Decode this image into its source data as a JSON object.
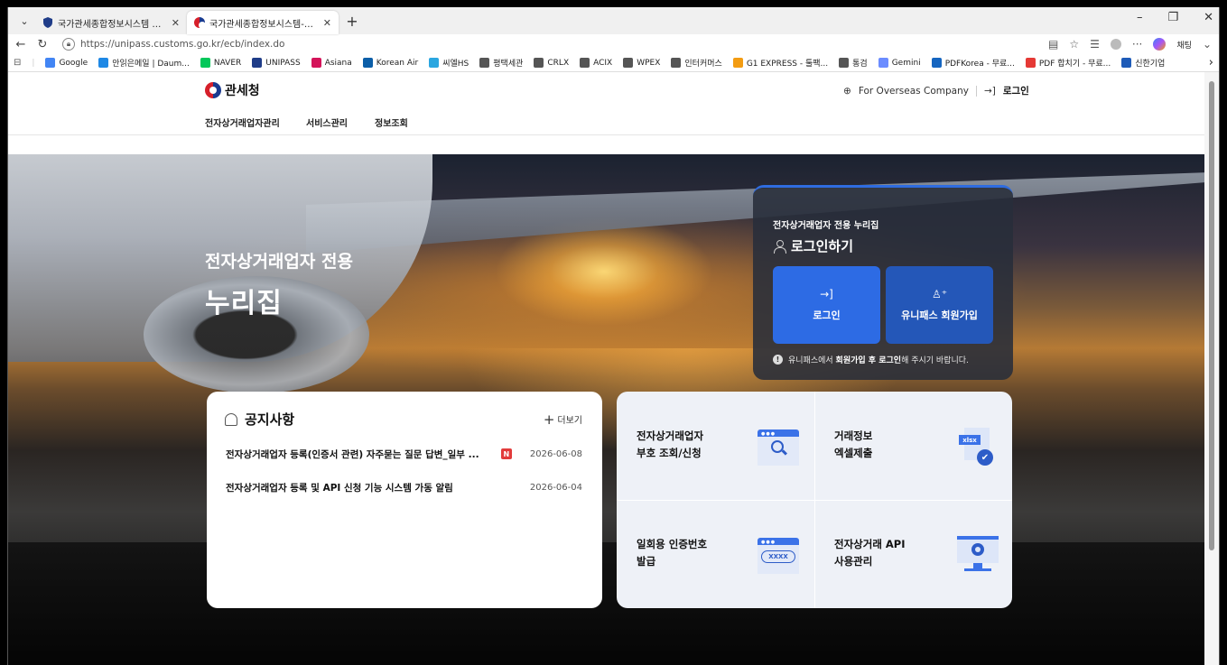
{
  "browser": {
    "tabs": [
      {
        "title": "국가관세종합정보시스템 서비스",
        "active": false
      },
      {
        "title": "국가관세종합정보시스템-전자상거래",
        "active": true
      }
    ],
    "url": "https://unipass.customs.go.kr/ecb/index.do",
    "profile_label": "채팅",
    "bookmarks": [
      "Google",
      "안읽은메일 | Daum...",
      "NAVER",
      "UNIPASS",
      "Asiana",
      "Korean Air",
      "씨엘HS",
      "평택세관",
      "CRLX",
      "ACIX",
      "WPEX",
      "인터커머스",
      "G1 EXPRESS - 툴팩...",
      "통검",
      "Gemini",
      "PDFKorea - 무료...",
      "PDF 합치기 - 무료...",
      "신한기업"
    ],
    "bookmark_colors": [
      "#4285f4",
      "#1e88e5",
      "#03c75a",
      "#1f3c88",
      "#d4145a",
      "#0b5ea8",
      "#2aa6e0",
      "#555",
      "#555",
      "#555",
      "#555",
      "#555",
      "#f39c12",
      "#555",
      "#6b8cff",
      "#1565c0",
      "#e53935",
      "#1e5bb8"
    ]
  },
  "header": {
    "logo_text": "관세청",
    "overseas_label": "For Overseas Company",
    "login_label": "로그인"
  },
  "gnb": [
    "전자상거래업자관리",
    "서비스관리",
    "정보조회"
  ],
  "hero": {
    "title_line1": "전자상거래업자 전용",
    "title_line2": "누리집"
  },
  "login_box": {
    "subtitle": "전자상거래업자 전용 누리집",
    "heading": "로그인하기",
    "login_button": "로그인",
    "join_button": "유니패스 회원가입",
    "note_pre": "유니패스에서 ",
    "note_bold": "회원가입 후 로그인",
    "note_post": "해 주시기 바랍니다."
  },
  "notice": {
    "title": "공지사항",
    "more_label": "더보기",
    "items": [
      {
        "title": "전자상거래업자 등록(인증서 관련) 자주묻는 질문 답변_일부 ...",
        "new_badge": "N",
        "date": "2026-06-08"
      },
      {
        "title": "전자상거래업자 등록 및 API 신청 기능 시스템 가동 알림",
        "new_badge": "",
        "date": "2026-06-04"
      }
    ]
  },
  "services": [
    {
      "line1": "전자상거래업자",
      "line2": "부호 조회/신청",
      "icon": "search-browser-icon"
    },
    {
      "line1": "거래정보",
      "line2": "엑셀제출",
      "icon": "xlsx-check-icon",
      "icon_text": "xlsx"
    },
    {
      "line1": "일회용 인증번호",
      "line2": "발급",
      "icon": "otp-browser-icon",
      "icon_text": "XXXX"
    },
    {
      "line1": "전자상거래 API",
      "line2": "사용관리",
      "icon": "monitor-gear-icon"
    }
  ]
}
